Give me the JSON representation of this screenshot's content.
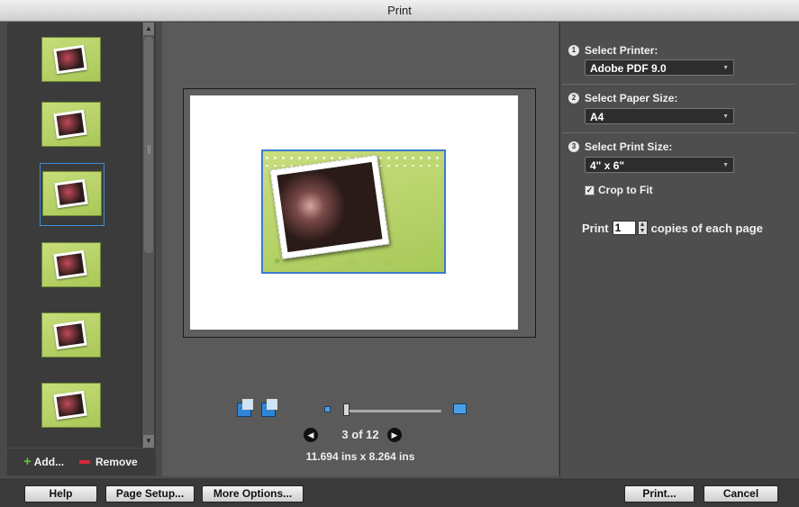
{
  "window": {
    "title": "Print"
  },
  "thumbnails": {
    "items": [
      {
        "selected": false
      },
      {
        "selected": false
      },
      {
        "selected": true
      },
      {
        "selected": false
      },
      {
        "selected": false
      },
      {
        "selected": false
      }
    ]
  },
  "thumb_actions": {
    "add_label": "Add...",
    "remove_label": "Remove"
  },
  "preview": {
    "page_indicator": "3 of 12",
    "page_dimensions": "11.694 ins x 8.264 ins"
  },
  "settings": {
    "printer": {
      "step": "1",
      "label": "Select Printer:",
      "value": "Adobe PDF 9.0"
    },
    "paper": {
      "step": "2",
      "label": "Select Paper Size:",
      "value": "A4"
    },
    "print_size": {
      "step": "3",
      "label": "Select Print Size:",
      "value": "4\" x 6\""
    },
    "crop_to_fit": {
      "label": "Crop to Fit",
      "checked": true
    },
    "copies": {
      "prefix": "Print",
      "value": "1",
      "suffix": "copies of each page"
    }
  },
  "footer": {
    "help": "Help",
    "page_setup": "Page Setup...",
    "more_options": "More Options...",
    "print": "Print...",
    "cancel": "Cancel"
  },
  "colors": {
    "selection_blue": "#3b7ad0",
    "card_green": "#b5d067"
  }
}
